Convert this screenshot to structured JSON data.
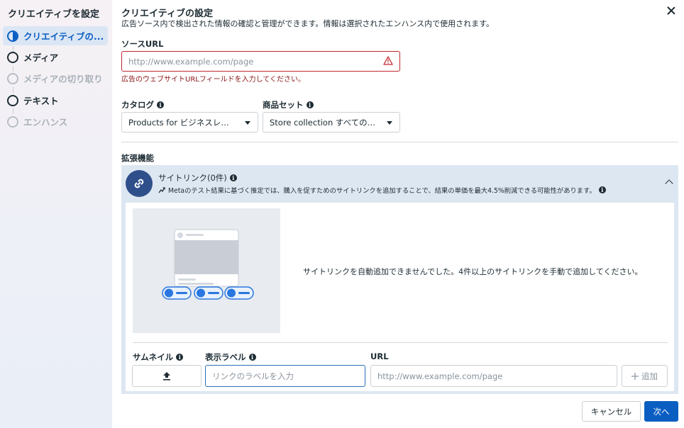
{
  "sidebar": {
    "title": "クリエイティブを設定",
    "items": [
      {
        "label": "クリエイティブの..."
      },
      {
        "label": "メディア"
      },
      {
        "label": "メディアの切り取り"
      },
      {
        "label": "テキスト"
      },
      {
        "label": "エンハンス"
      }
    ]
  },
  "header": {
    "title": "クリエイティブの設定",
    "subtitle": "広告ソース内で検出された情報の確認と管理ができます。情報は選択されたエンハンス内で使用されます。"
  },
  "source_url": {
    "label": "ソースURL",
    "placeholder": "http://www.example.com/page",
    "error": "広告のウェブサイトURLフィールドを入力してください。"
  },
  "catalog": {
    "label": "カタログ",
    "value": "Products for ビジネスレザー..."
  },
  "product_set": {
    "label": "商品セット",
    "value": "Store collection すべての商品"
  },
  "extensions": {
    "heading": "拡張機能",
    "sitelinks": {
      "title": "サイトリンク(0件)",
      "description": "Metaのテスト結果に基づく推定では、購入を促すためのサイトリンクを追加することで、結果の単価を最大4.5%削減できる可能性があります。",
      "notice": "サイトリンクを自動追加できませんでした。4件以上のサイトリンクを手動で追加してください。",
      "thumbnail_label": "サムネイル",
      "display_label": "表示ラベル",
      "display_placeholder": "リンクのラベルを入力",
      "url_label": "URL",
      "url_placeholder": "http://www.example.com/page",
      "add_label": "追加"
    }
  },
  "footer": {
    "cancel": "キャンセル",
    "next": "次へ"
  },
  "colors": {
    "accent": "#0a5ec2",
    "error": "#c1272d",
    "panel": "#dde7f2"
  }
}
